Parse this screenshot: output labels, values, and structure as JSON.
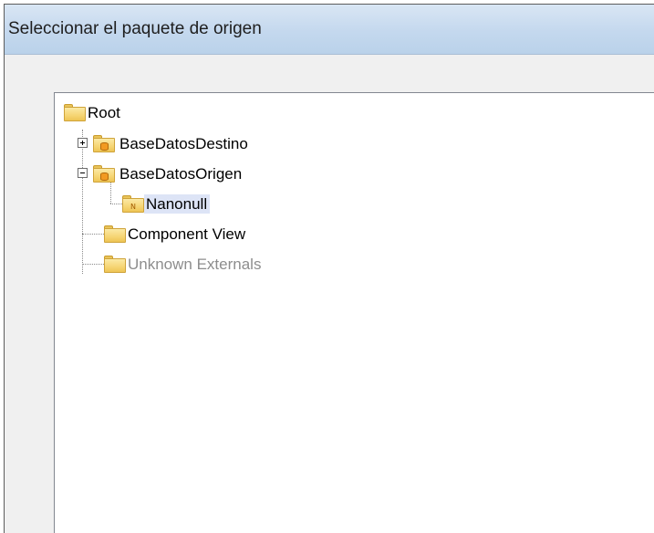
{
  "dialog": {
    "title": "Seleccionar el paquete de origen"
  },
  "tree": {
    "root": {
      "label": "Root",
      "icon": "folder-icon"
    },
    "nodes": [
      {
        "label": "BaseDatosDestino",
        "icon": "database-folder-icon",
        "expander": "plus"
      },
      {
        "label": "BaseDatosOrigen",
        "icon": "database-folder-icon",
        "expander": "minus"
      },
      {
        "label": "Nanonull",
        "icon": "namespace-folder-icon",
        "badge": "N",
        "selected": true
      },
      {
        "label": "Component View",
        "icon": "folder-icon"
      },
      {
        "label": "Unknown Externals",
        "icon": "folder-icon",
        "disabled": true
      }
    ]
  },
  "colors": {
    "titlebar": "#c4d8ee",
    "selection": "#dde4f6",
    "disabled_text": "#8d8d8d",
    "folder": "#f6d574"
  }
}
